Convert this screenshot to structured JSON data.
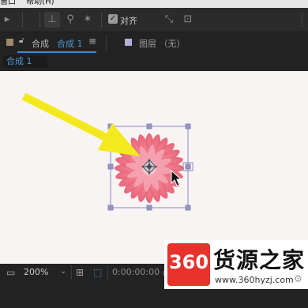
{
  "menubar": {
    "items": [
      "窗口",
      "帮助(H)"
    ]
  },
  "toolbar": {
    "snap_label": "对齐"
  },
  "composition_panel": {
    "tab_prefix": "合成",
    "tab_active": "合成 1",
    "menu_icon": "hamburger-icon",
    "layer_panel_label": "图层 （无）",
    "sub_tab": "合成 1",
    "colors": {
      "tab_swatch": "#a08a6a",
      "layer_swatch": "#b0b0d8",
      "active_underline": "#3d8bd8"
    }
  },
  "viewer": {
    "background": "#f8f4f4",
    "layer": "pink-flower",
    "annotation": "yellow-arrow",
    "colors": {
      "arrow": "#f2ea1e",
      "flower": "#f27e8e",
      "bbox": "#8888bb"
    }
  },
  "bottom_bar": {
    "zoom": "200%",
    "timecode": "0:00:00:00"
  },
  "watermark": {
    "logo": "360",
    "title": "货源之家",
    "url": "www.360hyzj.com"
  }
}
